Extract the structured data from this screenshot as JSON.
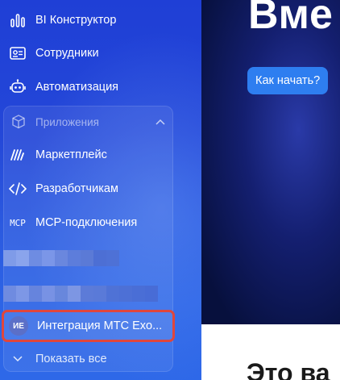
{
  "sidebar": {
    "items": [
      {
        "label": "BI Конструктор",
        "icon": "bar-chart-icon"
      },
      {
        "label": "Сотрудники",
        "icon": "id-card-icon"
      },
      {
        "label": "Автоматизация",
        "icon": "robot-icon"
      }
    ],
    "apps": {
      "header": "Приложения",
      "header_icon": "box-icon",
      "items": [
        {
          "label": "Маркетплейс",
          "icon": "marketplace-icon"
        },
        {
          "label": "Разработчикам",
          "icon": "code-icon"
        },
        {
          "label": "MCP-подключения",
          "icon_text": "MCP"
        }
      ],
      "highlighted": {
        "avatar": "ИЕ",
        "label": "Интеграция МТС Exo..."
      },
      "show_all": "Показать все"
    }
  },
  "main": {
    "hero_title": "Вме",
    "hero_button": "Как начать?",
    "lower_title": "Это ва"
  },
  "colors": {
    "sidebar_accent": "#2447d8",
    "button": "#2e7ef0",
    "highlight_border": "#e0463c"
  }
}
